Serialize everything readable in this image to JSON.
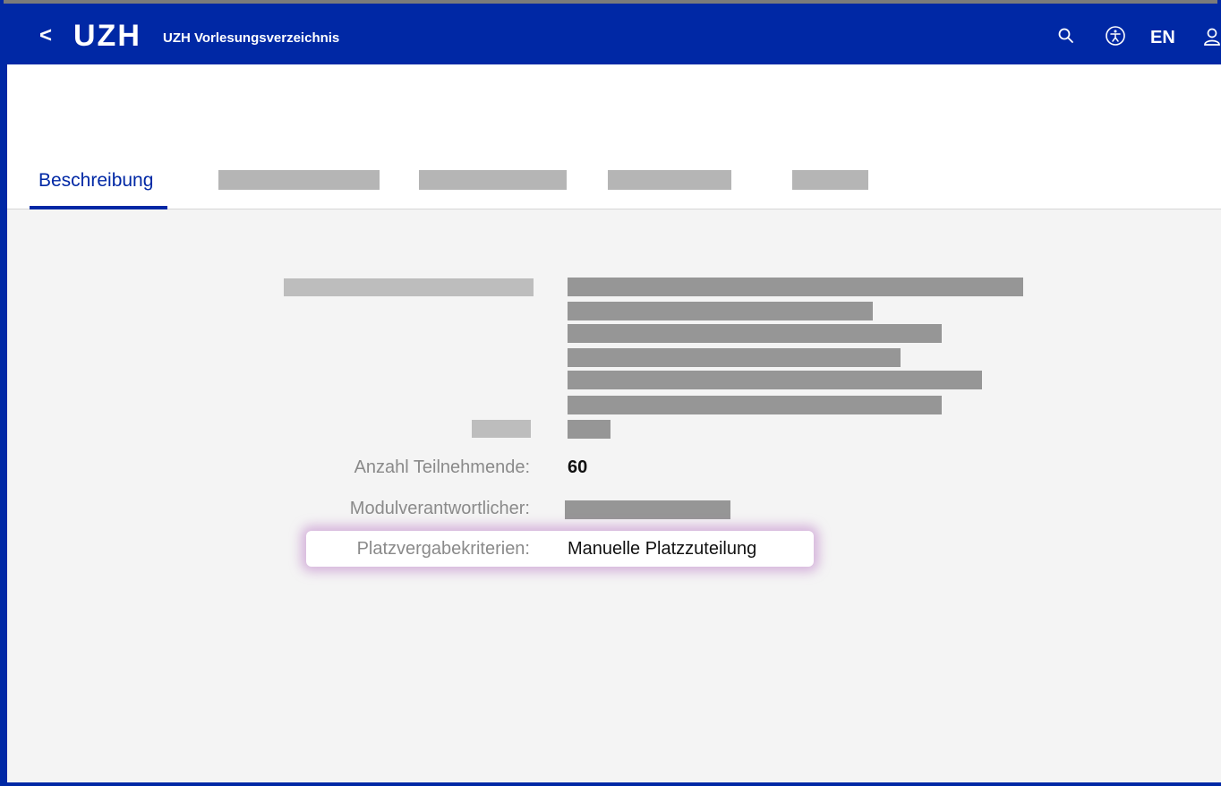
{
  "header": {
    "back_symbol": "<",
    "logo": "UZH",
    "app_title": "UZH Vorlesungsverzeichnis",
    "language": "EN",
    "icons": [
      "search-icon",
      "accessibility-icon",
      "user-icon"
    ],
    "brand_color": "#0028a5"
  },
  "tabs": {
    "active_label": "Beschreibung"
  },
  "details": {
    "participants_label": "Anzahl Teilnehmende:",
    "participants_value": "60",
    "responsible_label": "Modulverantwortlicher:",
    "criteria_label": "Platzvergabekriterien:",
    "criteria_value": "Manuelle Platzzuteilung"
  }
}
